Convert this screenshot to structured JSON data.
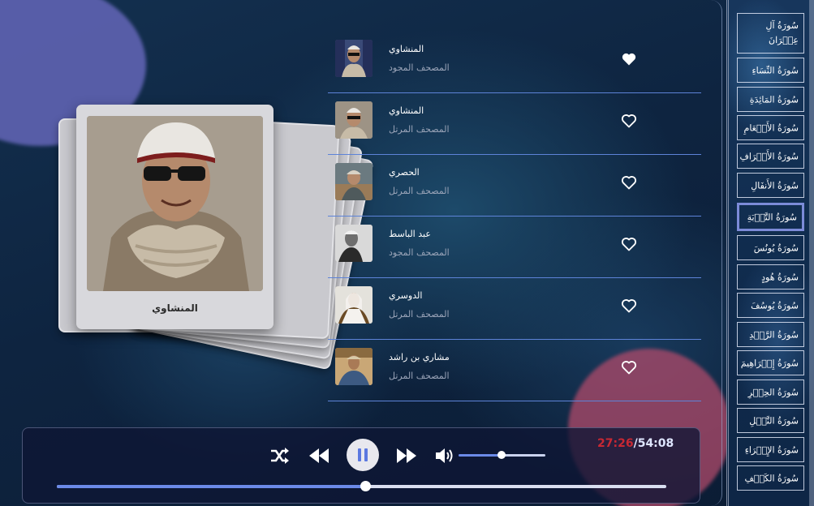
{
  "now_playing": {
    "caption": "المنشاوي"
  },
  "reciters": [
    {
      "name": "المنشاوي",
      "mushaf": "المصحف المجود",
      "favorited": true
    },
    {
      "name": "المنشاوي",
      "mushaf": "المصحف المرتل",
      "favorited": false
    },
    {
      "name": "الحصري",
      "mushaf": "المصحف المرتل",
      "favorited": false
    },
    {
      "name": "عبد الباسط",
      "mushaf": "المصحف المجود",
      "favorited": false
    },
    {
      "name": "الدوسري",
      "mushaf": "المصحف المرتل",
      "favorited": false
    },
    {
      "name": "مشاري بن راشد",
      "mushaf": "المصحف المرتل",
      "favorited": false
    }
  ],
  "player": {
    "time_current": "27:26",
    "time_separator": "/",
    "time_total": "54:08",
    "progress": 0.5,
    "volume": 0.5
  },
  "surahs": [
    {
      "label": "سُورَةُ آلِ عِمۡرَانَ",
      "active": false
    },
    {
      "label": "سُورَةُ النِّسَاءِ",
      "active": false
    },
    {
      "label": "سُورَةُ المَائِدَةِ",
      "active": false
    },
    {
      "label": "سُورَةُ الأَنۡعَامِ",
      "active": false
    },
    {
      "label": "سُورَةُ الأَعۡرَافِ",
      "active": false
    },
    {
      "label": "سُورَةُ الأَنفَالِ",
      "active": false
    },
    {
      "label": "سُورَةُ التَّوۡبَةِ",
      "active": true
    },
    {
      "label": "سُورَةُ يُونُسَ",
      "active": false
    },
    {
      "label": "سُورَةُ هُودٍ",
      "active": false
    },
    {
      "label": "سُورَةُ يُوسُفَ",
      "active": false
    },
    {
      "label": "سُورَةُ الرَّعۡدِ",
      "active": false
    },
    {
      "label": "سُورَةُ إِبۡرَاهِيمَ",
      "active": false
    },
    {
      "label": "سُورَةُ الحِجۡرِ",
      "active": false
    },
    {
      "label": "سُورَةُ النَّحۡلِ",
      "active": false
    },
    {
      "label": "سُورَةُ الإِسۡرَاءِ",
      "active": false
    },
    {
      "label": "سُورَةُ الكَهۡفِ",
      "active": false
    }
  ],
  "colors": {
    "accent": "#6b8ae8",
    "time_current": "#c82833",
    "divider": "#5d83d8"
  }
}
